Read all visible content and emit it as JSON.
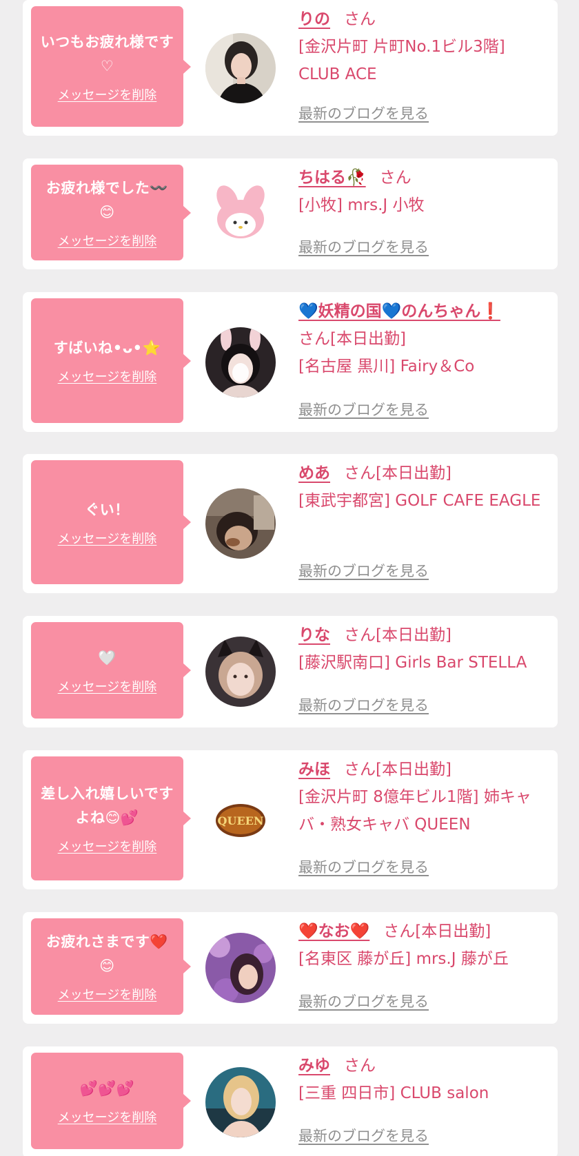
{
  "delete_label": "メッセージを削除",
  "blog_label": "最新のブログを見る",
  "san_label": "さん",
  "colors": {
    "accent": "#d9486c",
    "bubble": "#f98fa3",
    "link_gray": "#8f8f8f",
    "background": "#efeeef"
  },
  "cards": [
    {
      "message": "いつもお疲れ様です♡",
      "name": "りの",
      "suffix": "さん",
      "shop": "[金沢片町 片町No.1ビル3階] CLUB ACE",
      "avatar": "photo-woman-dark-hair"
    },
    {
      "message": "お疲れ様でした〰️ 😊",
      "name": "ちはる🥀",
      "suffix": "さん",
      "shop": "[小牧] mrs.J 小牧",
      "avatar": "plush-toy-pink"
    },
    {
      "message": "すばいね•ᴗ•⭐",
      "name": "💙妖精の国💙のんちゃん❗️",
      "suffix": "さん[本日出勤]",
      "shop": "[名古屋 黒川] Fairy＆Co",
      "avatar": "photo-bunny-ears"
    },
    {
      "message": "ぐい！",
      "name": "めあ",
      "suffix": "さん[本日出勤]",
      "shop": "[東武宇都宮] GOLF CAFE EAGLE",
      "avatar": "photo-selfie-filter"
    },
    {
      "message": "🤍",
      "name": "りな",
      "suffix": "さん[本日出勤]",
      "shop": "[藤沢駅南口] Girls Bar STELLA",
      "avatar": "photo-cat-ears"
    },
    {
      "message": "差し入れ嬉しいですよね😊💕",
      "name": "みほ",
      "suffix": "さん[本日出勤]",
      "shop": "[金沢片町 8億年ビル1階] 姉キャバ・熟女キャバ QUEEN",
      "avatar": "queen-logo"
    },
    {
      "message": "お疲れさまです❤️ 😊",
      "name": "❤️なお❤️",
      "suffix": "さん[本日出勤]",
      "shop": "[名東区 藤が丘] mrs.J 藤が丘",
      "avatar": "photo-purple-flowers"
    },
    {
      "message": "💕💕💕",
      "name": "みゆ",
      "suffix": "さん",
      "shop": "[三重 四日市] CLUB salon",
      "avatar": "photo-blonde-woman"
    }
  ]
}
